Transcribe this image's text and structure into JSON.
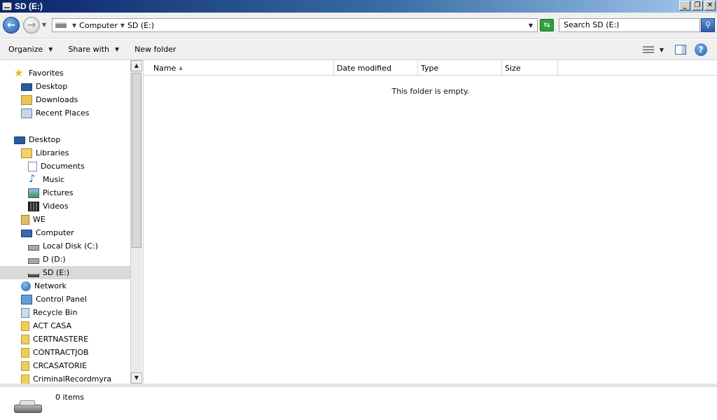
{
  "window": {
    "title": "SD (E:)",
    "controls": {
      "minimize": "_",
      "restore": "❐",
      "close": "✕"
    }
  },
  "address": {
    "crumbs": [
      "Computer",
      "SD (E:)"
    ],
    "search_placeholder": "Search SD (E:)"
  },
  "toolbar": {
    "organize": "Organize",
    "share_with": "Share with",
    "new_folder": "New folder"
  },
  "nav": {
    "items": [
      {
        "label": "Favorites",
        "icon": "star-icon"
      },
      {
        "label": "Desktop",
        "icon": "desktop-icon"
      },
      {
        "label": "Downloads",
        "icon": "downloads-icon"
      },
      {
        "label": "Recent Places",
        "icon": "recent-places-icon"
      },
      {
        "label": "Desktop",
        "icon": "desktop-icon"
      },
      {
        "label": "Libraries",
        "icon": "libraries-icon"
      },
      {
        "label": "Documents",
        "icon": "documents-icon"
      },
      {
        "label": "Music",
        "icon": "music-icon"
      },
      {
        "label": "Pictures",
        "icon": "pictures-icon"
      },
      {
        "label": "Videos",
        "icon": "videos-icon"
      },
      {
        "label": "WE",
        "icon": "user-folder-icon"
      },
      {
        "label": "Computer",
        "icon": "computer-icon"
      },
      {
        "label": "Local Disk (C:)",
        "icon": "local-disk-icon"
      },
      {
        "label": "D (D:)",
        "icon": "drive-icon"
      },
      {
        "label": "SD (E:)",
        "icon": "sd-drive-icon",
        "selected": true
      },
      {
        "label": "Network",
        "icon": "network-icon"
      },
      {
        "label": "Control Panel",
        "icon": "control-panel-icon"
      },
      {
        "label": "Recycle Bin",
        "icon": "recycle-bin-icon"
      },
      {
        "label": "ACT CASA",
        "icon": "folder-icon"
      },
      {
        "label": "CERTNASTERE",
        "icon": "folder-icon"
      },
      {
        "label": "CONTRACTJOB",
        "icon": "folder-icon"
      },
      {
        "label": "CRCASATORIE",
        "icon": "folder-icon"
      },
      {
        "label": "CriminalRecordmyra",
        "icon": "folder-icon"
      }
    ]
  },
  "columns": {
    "name": "Name",
    "date_modified": "Date modified",
    "type": "Type",
    "size": "Size"
  },
  "content": {
    "empty_message": "This folder is empty."
  },
  "details": {
    "item_count": "0 items"
  }
}
